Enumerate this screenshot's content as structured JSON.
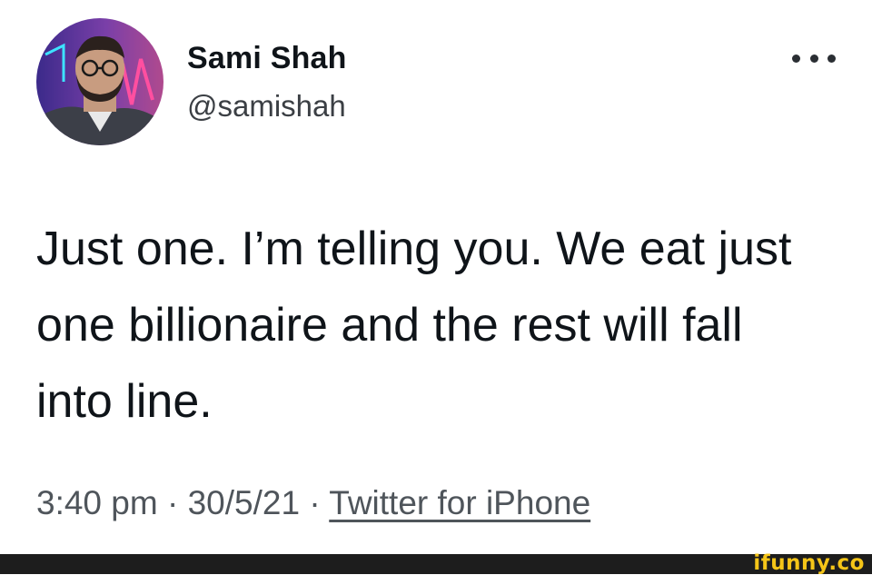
{
  "author": {
    "display_name": "Sami Shah",
    "handle": "@samishah"
  },
  "tweet": {
    "lines": [
      "Just one. I’m telling you. We eat just",
      "one billionaire and the rest will fall",
      "into line."
    ]
  },
  "meta": {
    "time": "3:40 pm",
    "separator": "·",
    "date": "30/5/21",
    "source": "Twitter for iPhone"
  },
  "more_icon": "more-horizontal-icon",
  "watermark": "ifunny.co",
  "colors": {
    "text": "#0f1419",
    "secondary": "#4f555b",
    "footer_bar": "#1d1d1d",
    "watermark": "#f5c518"
  }
}
